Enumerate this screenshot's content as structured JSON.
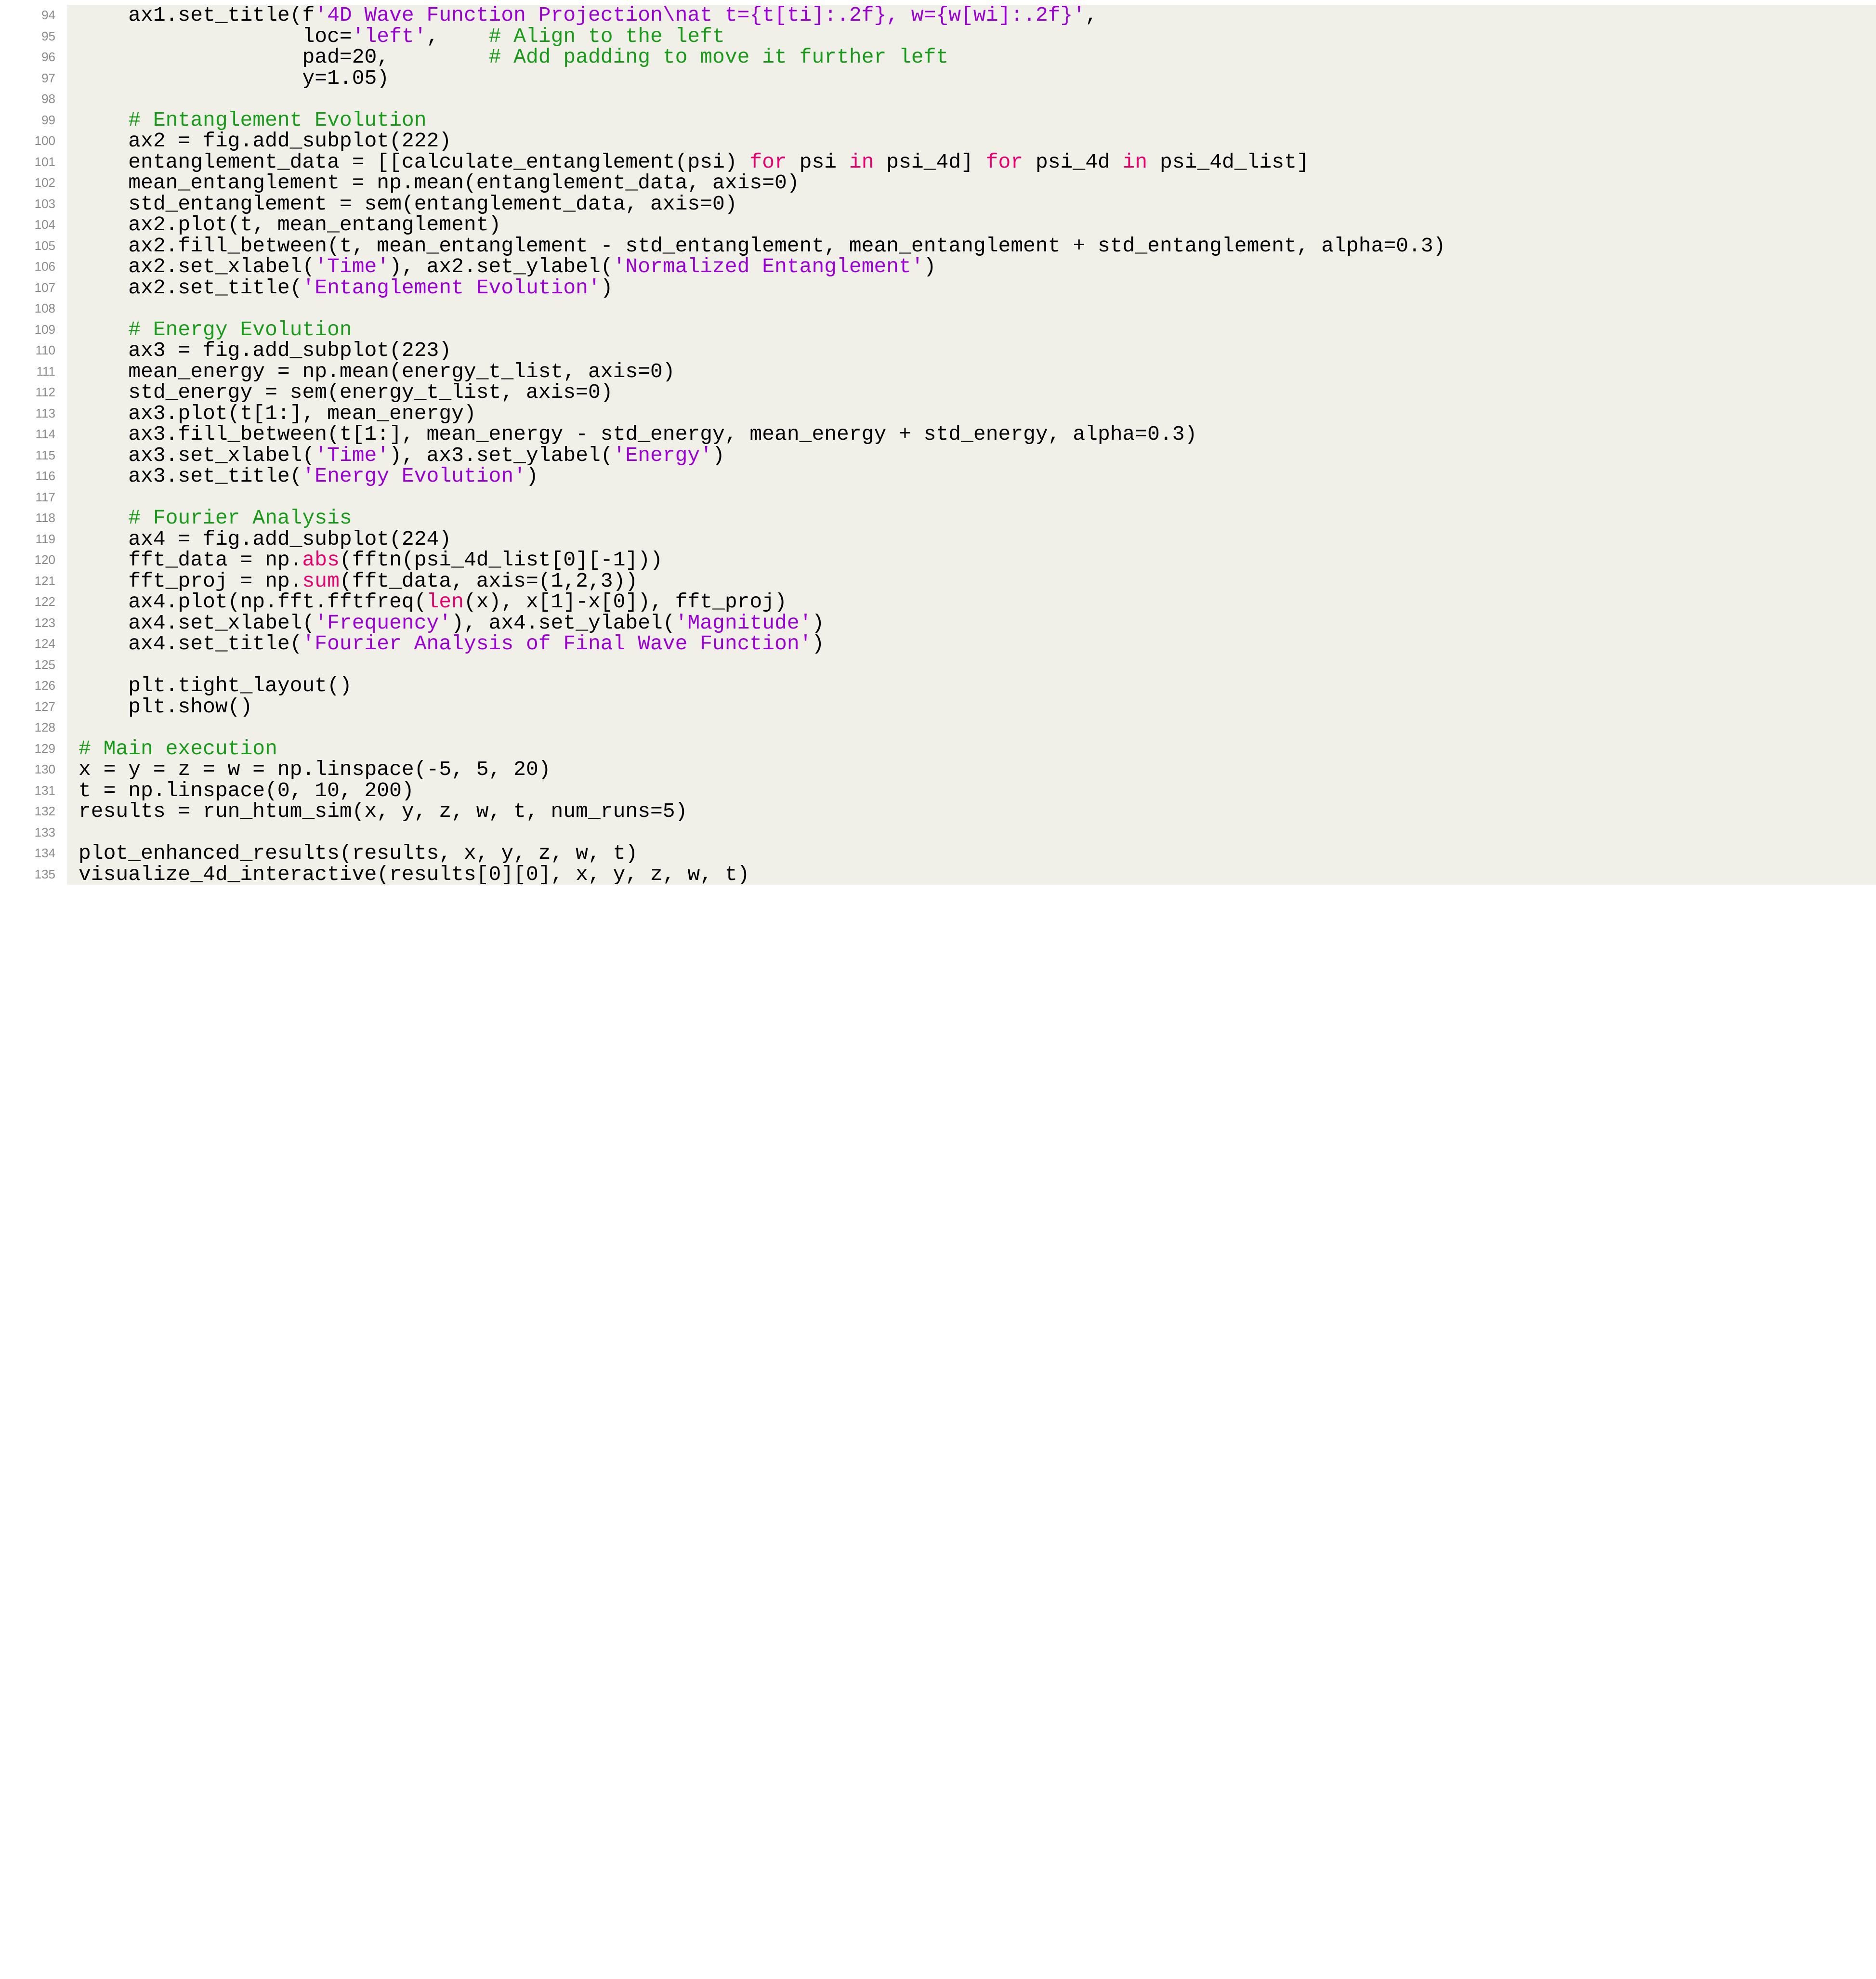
{
  "listing": {
    "language": "python",
    "first_line_number": 94,
    "last_line_number": 135,
    "colors": {
      "background": "#f1f0e8",
      "page": "#ffffff",
      "line_number": "#8a8a8a",
      "plain": "#000000",
      "comment": "#1a9a1a",
      "string": "#9b00d3",
      "keyword": "#e8006f",
      "builtin": "#e8006f"
    },
    "lines": [
      {
        "number": "94",
        "tokens": [
          {
            "t": "    ax1.set_title(f",
            "c": "plain"
          },
          {
            "t": "'4D Wave Function Projection\\nat t={t[ti]:.2f}, w={w[wi]:.2f}'",
            "c": "string"
          },
          {
            "t": ",",
            "c": "plain"
          }
        ]
      },
      {
        "number": "95",
        "tokens": [
          {
            "t": "                  loc=",
            "c": "plain"
          },
          {
            "t": "'left'",
            "c": "string"
          },
          {
            "t": ",    ",
            "c": "plain"
          },
          {
            "t": "# Align to the left",
            "c": "comment"
          }
        ]
      },
      {
        "number": "96",
        "tokens": [
          {
            "t": "                  pad=20,        ",
            "c": "plain"
          },
          {
            "t": "# Add padding to move it further left",
            "c": "comment"
          }
        ]
      },
      {
        "number": "97",
        "tokens": [
          {
            "t": "                  y=1.05)",
            "c": "plain"
          }
        ]
      },
      {
        "number": "98",
        "tokens": []
      },
      {
        "number": "99",
        "tokens": [
          {
            "t": "    ",
            "c": "plain"
          },
          {
            "t": "# Entanglement Evolution",
            "c": "comment"
          }
        ]
      },
      {
        "number": "100",
        "tokens": [
          {
            "t": "    ax2 = fig.add_subplot(222)",
            "c": "plain"
          }
        ]
      },
      {
        "number": "101",
        "tokens": [
          {
            "t": "    entanglement_data = [[calculate_entanglement(psi) ",
            "c": "plain"
          },
          {
            "t": "for",
            "c": "kw"
          },
          {
            "t": " psi ",
            "c": "plain"
          },
          {
            "t": "in",
            "c": "kw"
          },
          {
            "t": " psi_4d] ",
            "c": "plain"
          },
          {
            "t": "for",
            "c": "kw"
          },
          {
            "t": " psi_4d ",
            "c": "plain"
          },
          {
            "t": "in",
            "c": "kw"
          },
          {
            "t": " psi_4d_list]",
            "c": "plain"
          }
        ]
      },
      {
        "number": "102",
        "tokens": [
          {
            "t": "    mean_entanglement = np.mean(entanglement_data, axis=0)",
            "c": "plain"
          }
        ]
      },
      {
        "number": "103",
        "tokens": [
          {
            "t": "    std_entanglement = sem(entanglement_data, axis=0)",
            "c": "plain"
          }
        ]
      },
      {
        "number": "104",
        "tokens": [
          {
            "t": "    ax2.plot(t, mean_entanglement)",
            "c": "plain"
          }
        ]
      },
      {
        "number": "105",
        "tokens": [
          {
            "t": "    ax2.fill_between(t, mean_entanglement - std_entanglement, mean_entanglement + std_entanglement, alpha=0.3)",
            "c": "plain"
          }
        ]
      },
      {
        "number": "106",
        "tokens": [
          {
            "t": "    ax2.set_xlabel(",
            "c": "plain"
          },
          {
            "t": "'Time'",
            "c": "string"
          },
          {
            "t": "), ax2.set_ylabel(",
            "c": "plain"
          },
          {
            "t": "'Normalized Entanglement'",
            "c": "string"
          },
          {
            "t": ")",
            "c": "plain"
          }
        ]
      },
      {
        "number": "107",
        "tokens": [
          {
            "t": "    ax2.set_title(",
            "c": "plain"
          },
          {
            "t": "'Entanglement Evolution'",
            "c": "string"
          },
          {
            "t": ")",
            "c": "plain"
          }
        ]
      },
      {
        "number": "108",
        "tokens": []
      },
      {
        "number": "109",
        "tokens": [
          {
            "t": "    ",
            "c": "plain"
          },
          {
            "t": "# Energy Evolution",
            "c": "comment"
          }
        ]
      },
      {
        "number": "110",
        "tokens": [
          {
            "t": "    ax3 = fig.add_subplot(223)",
            "c": "plain"
          }
        ]
      },
      {
        "number": "111",
        "tokens": [
          {
            "t": "    mean_energy = np.mean(energy_t_list, axis=0)",
            "c": "plain"
          }
        ]
      },
      {
        "number": "112",
        "tokens": [
          {
            "t": "    std_energy = sem(energy_t_list, axis=0)",
            "c": "plain"
          }
        ]
      },
      {
        "number": "113",
        "tokens": [
          {
            "t": "    ax3.plot(t[1:], mean_energy)",
            "c": "plain"
          }
        ]
      },
      {
        "number": "114",
        "tokens": [
          {
            "t": "    ax3.fill_between(t[1:], mean_energy - std_energy, mean_energy + std_energy, alpha=0.3)",
            "c": "plain"
          }
        ]
      },
      {
        "number": "115",
        "tokens": [
          {
            "t": "    ax3.set_xlabel(",
            "c": "plain"
          },
          {
            "t": "'Time'",
            "c": "string"
          },
          {
            "t": "), ax3.set_ylabel(",
            "c": "plain"
          },
          {
            "t": "'Energy'",
            "c": "string"
          },
          {
            "t": ")",
            "c": "plain"
          }
        ]
      },
      {
        "number": "116",
        "tokens": [
          {
            "t": "    ax3.set_title(",
            "c": "plain"
          },
          {
            "t": "'Energy Evolution'",
            "c": "string"
          },
          {
            "t": ")",
            "c": "plain"
          }
        ]
      },
      {
        "number": "117",
        "tokens": []
      },
      {
        "number": "118",
        "tokens": [
          {
            "t": "    ",
            "c": "plain"
          },
          {
            "t": "# Fourier Analysis",
            "c": "comment"
          }
        ]
      },
      {
        "number": "119",
        "tokens": [
          {
            "t": "    ax4 = fig.add_subplot(224)",
            "c": "plain"
          }
        ]
      },
      {
        "number": "120",
        "tokens": [
          {
            "t": "    fft_data = np.",
            "c": "plain"
          },
          {
            "t": "abs",
            "c": "builtin"
          },
          {
            "t": "(fftn(psi_4d_list[0][-1]))",
            "c": "plain"
          }
        ]
      },
      {
        "number": "121",
        "tokens": [
          {
            "t": "    fft_proj = np.",
            "c": "plain"
          },
          {
            "t": "sum",
            "c": "builtin"
          },
          {
            "t": "(fft_data, axis=(1,2,3))",
            "c": "plain"
          }
        ]
      },
      {
        "number": "122",
        "tokens": [
          {
            "t": "    ax4.plot(np.fft.fftfreq(",
            "c": "plain"
          },
          {
            "t": "len",
            "c": "builtin"
          },
          {
            "t": "(x), x[1]-x[0]), fft_proj)",
            "c": "plain"
          }
        ]
      },
      {
        "number": "123",
        "tokens": [
          {
            "t": "    ax4.set_xlabel(",
            "c": "plain"
          },
          {
            "t": "'Frequency'",
            "c": "string"
          },
          {
            "t": "), ax4.set_ylabel(",
            "c": "plain"
          },
          {
            "t": "'Magnitude'",
            "c": "string"
          },
          {
            "t": ")",
            "c": "plain"
          }
        ]
      },
      {
        "number": "124",
        "tokens": [
          {
            "t": "    ax4.set_title(",
            "c": "plain"
          },
          {
            "t": "'Fourier Analysis of Final Wave Function'",
            "c": "string"
          },
          {
            "t": ")",
            "c": "plain"
          }
        ]
      },
      {
        "number": "125",
        "tokens": []
      },
      {
        "number": "126",
        "tokens": [
          {
            "t": "    plt.tight_layout()",
            "c": "plain"
          }
        ]
      },
      {
        "number": "127",
        "tokens": [
          {
            "t": "    plt.show()",
            "c": "plain"
          }
        ]
      },
      {
        "number": "128",
        "tokens": []
      },
      {
        "number": "129",
        "tokens": [
          {
            "t": "# Main execution",
            "c": "comment"
          }
        ]
      },
      {
        "number": "130",
        "tokens": [
          {
            "t": "x = y = z = w = np.linspace(-5, 5, 20)",
            "c": "plain"
          }
        ]
      },
      {
        "number": "131",
        "tokens": [
          {
            "t": "t = np.linspace(0, 10, 200)",
            "c": "plain"
          }
        ]
      },
      {
        "number": "132",
        "tokens": [
          {
            "t": "results = run_htum_sim(x, y, z, w, t, num_runs=5)",
            "c": "plain"
          }
        ]
      },
      {
        "number": "133",
        "tokens": []
      },
      {
        "number": "134",
        "tokens": [
          {
            "t": "plot_enhanced_results(results, x, y, z, w, t)",
            "c": "plain"
          }
        ]
      },
      {
        "number": "135",
        "tokens": [
          {
            "t": "visualize_4d_interactive(results[0][0], x, y, z, w, t)",
            "c": "plain"
          }
        ]
      }
    ]
  }
}
